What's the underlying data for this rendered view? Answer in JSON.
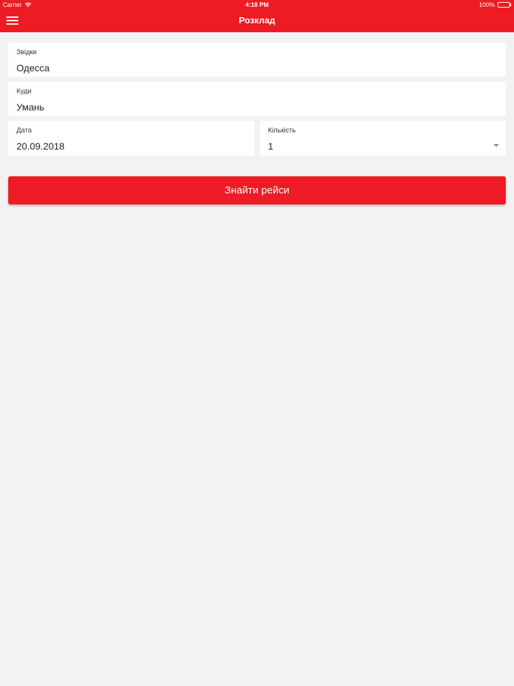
{
  "status_bar": {
    "carrier": "Carrier",
    "time": "4:18 PM",
    "battery": "100%",
    "battery_color": "#4cd964"
  },
  "nav": {
    "title": "Розклад",
    "menu_icon": "hamburger-menu-icon"
  },
  "form": {
    "from": {
      "label": "Звідки",
      "value": "Одесса"
    },
    "to": {
      "label": "Куди",
      "value": "Умань"
    },
    "date": {
      "label": "Дата",
      "value": "20.09.2018"
    },
    "count": {
      "label": "Кількість",
      "value": "1"
    }
  },
  "search_button": {
    "label": "Знайти рейси"
  },
  "colors": {
    "accent": "#ed1c24",
    "background": "#f2f2f2"
  }
}
